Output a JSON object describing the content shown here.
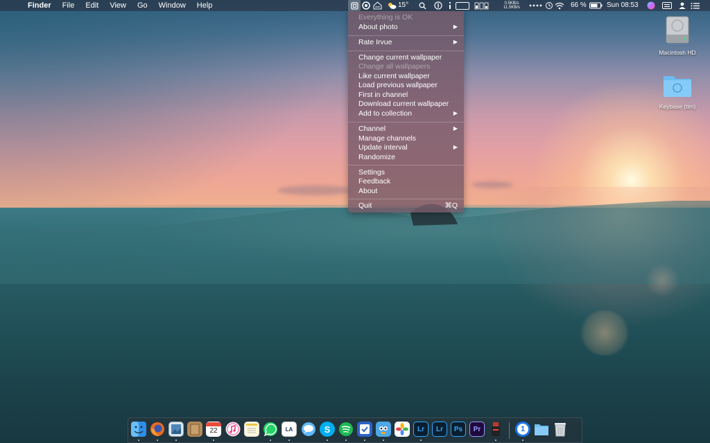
{
  "menubar": {
    "app_name": "Finder",
    "menus": [
      "File",
      "Edit",
      "View",
      "Go",
      "Window",
      "Help"
    ],
    "weather": "15°",
    "net_up": "0.5KB/s",
    "net_down": "11.5KB/s",
    "battery": "66 %",
    "clock": "Sun 08:53"
  },
  "dropdown": {
    "status": "Everything is OK",
    "about_photo": "About photo",
    "rate": "Rate Irvue",
    "change_current": "Change current wallpaper",
    "change_all": "Change all wallpapers",
    "like_current": "Like current wallpaper",
    "load_previous": "Load previous wallpaper",
    "first_in_channel": "First in channel",
    "download_current": "Download current wallpaper",
    "add_to_collection": "Add to collection",
    "channel": "Channel",
    "manage_channels": "Manage channels",
    "update_interval": "Update interval",
    "randomize": "Randomize",
    "settings": "Settings",
    "feedback": "Feedback",
    "about": "About",
    "quit": "Quit",
    "quit_shortcut": "⌘Q"
  },
  "desktop": {
    "drive_label": "Macintosh HD",
    "folder_label": "Keybase (tim)"
  },
  "dock": {
    "calendar_day": "22",
    "lr1": "Lr",
    "lr2": "Lr",
    "ps": "Ps",
    "pr": "Pr",
    "skype": "S",
    "la": "LA",
    "onepassword": "1"
  },
  "colors": {
    "menu_bg": "#7a5a69",
    "finder_blue": "#2f8ee6",
    "firefox_orange": "#e96a1f",
    "spotify_green": "#1db954",
    "whatsapp_green": "#25d366",
    "skype_blue": "#00aff0",
    "lightroom_blue": "#31a8ff",
    "photoshop_blue": "#31a8ff",
    "premiere_purple": "#9999ff",
    "calendar_red": "#e74c3c"
  }
}
